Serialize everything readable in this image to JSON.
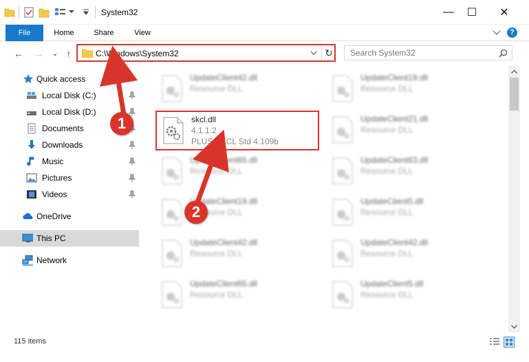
{
  "window": {
    "title": "System32",
    "minimize_glyph": "—",
    "maximize_glyph": "☐",
    "close_glyph": "✕"
  },
  "ribbon": {
    "tabs": [
      {
        "label": "File"
      },
      {
        "label": "Home"
      },
      {
        "label": "Share"
      },
      {
        "label": "View"
      }
    ],
    "help_glyph": "?"
  },
  "navigation": {
    "back_glyph": "←",
    "forward_glyph": "→",
    "recent_glyph": "⌄",
    "up_glyph": "↑",
    "address": "C:\\Windows\\System32",
    "refresh_glyph": "↻",
    "search_placeholder": "Search System32"
  },
  "sidebar": {
    "items": [
      {
        "label": "Quick access",
        "icon": "star-icon",
        "pinned": false
      },
      {
        "label": "Local Disk (C:)",
        "icon": "drive-icon",
        "pinned": true
      },
      {
        "label": "Local Disk (D:)",
        "icon": "drive-icon",
        "pinned": true
      },
      {
        "label": "Documents",
        "icon": "documents-icon",
        "pinned": true
      },
      {
        "label": "Downloads",
        "icon": "download-icon",
        "pinned": true
      },
      {
        "label": "Music",
        "icon": "music-icon",
        "pinned": true
      },
      {
        "label": "Pictures",
        "icon": "pictures-icon",
        "pinned": true
      },
      {
        "label": "Videos",
        "icon": "videos-icon",
        "pinned": true
      },
      {
        "label": "OneDrive",
        "icon": "cloud-icon",
        "pinned": false
      },
      {
        "label": "This PC",
        "icon": "computer-icon",
        "pinned": false,
        "selected": true
      },
      {
        "label": "Network",
        "icon": "network-icon",
        "pinned": false
      }
    ]
  },
  "files": {
    "highlighted": {
      "name": "skcl.dll",
      "version": "4.1.1.2",
      "description": "PLUS SKCL Std 4.109b"
    },
    "left_column": [
      {
        "name": "UpdateClient42.dll",
        "desc": "Resource DLL"
      },
      {
        "name": "UpdateClient65.dll",
        "desc": "Resource DLL"
      },
      {
        "name": "UpdateClient19.dll",
        "desc": "Resource DLL"
      },
      {
        "name": "UpdateClient42.dll",
        "desc": "Resource DLL"
      },
      {
        "name": "UpdateClient65.dll",
        "desc": "Resource DLL"
      }
    ],
    "right_column": [
      {
        "name": "UpdateClient19.dll",
        "desc": "Resource DLL"
      },
      {
        "name": "UpdateClient21.dll",
        "desc": "Resource DLL"
      },
      {
        "name": "UpdateClient63.dll",
        "desc": "Resource DLL"
      },
      {
        "name": "UpdateClient5.dll",
        "desc": "Resource DLL"
      },
      {
        "name": "UpdateClient42.dll",
        "desc": "Resource DLL"
      },
      {
        "name": "UpdateClient5.dll",
        "desc": "Resource DLL"
      }
    ]
  },
  "status": {
    "item_count": "115 items"
  },
  "callouts": [
    {
      "label": "1"
    },
    {
      "label": "2"
    }
  ],
  "colors": {
    "accent": "#1979ca",
    "highlight_red": "#e0302a",
    "callout_red": "#d9342b"
  }
}
